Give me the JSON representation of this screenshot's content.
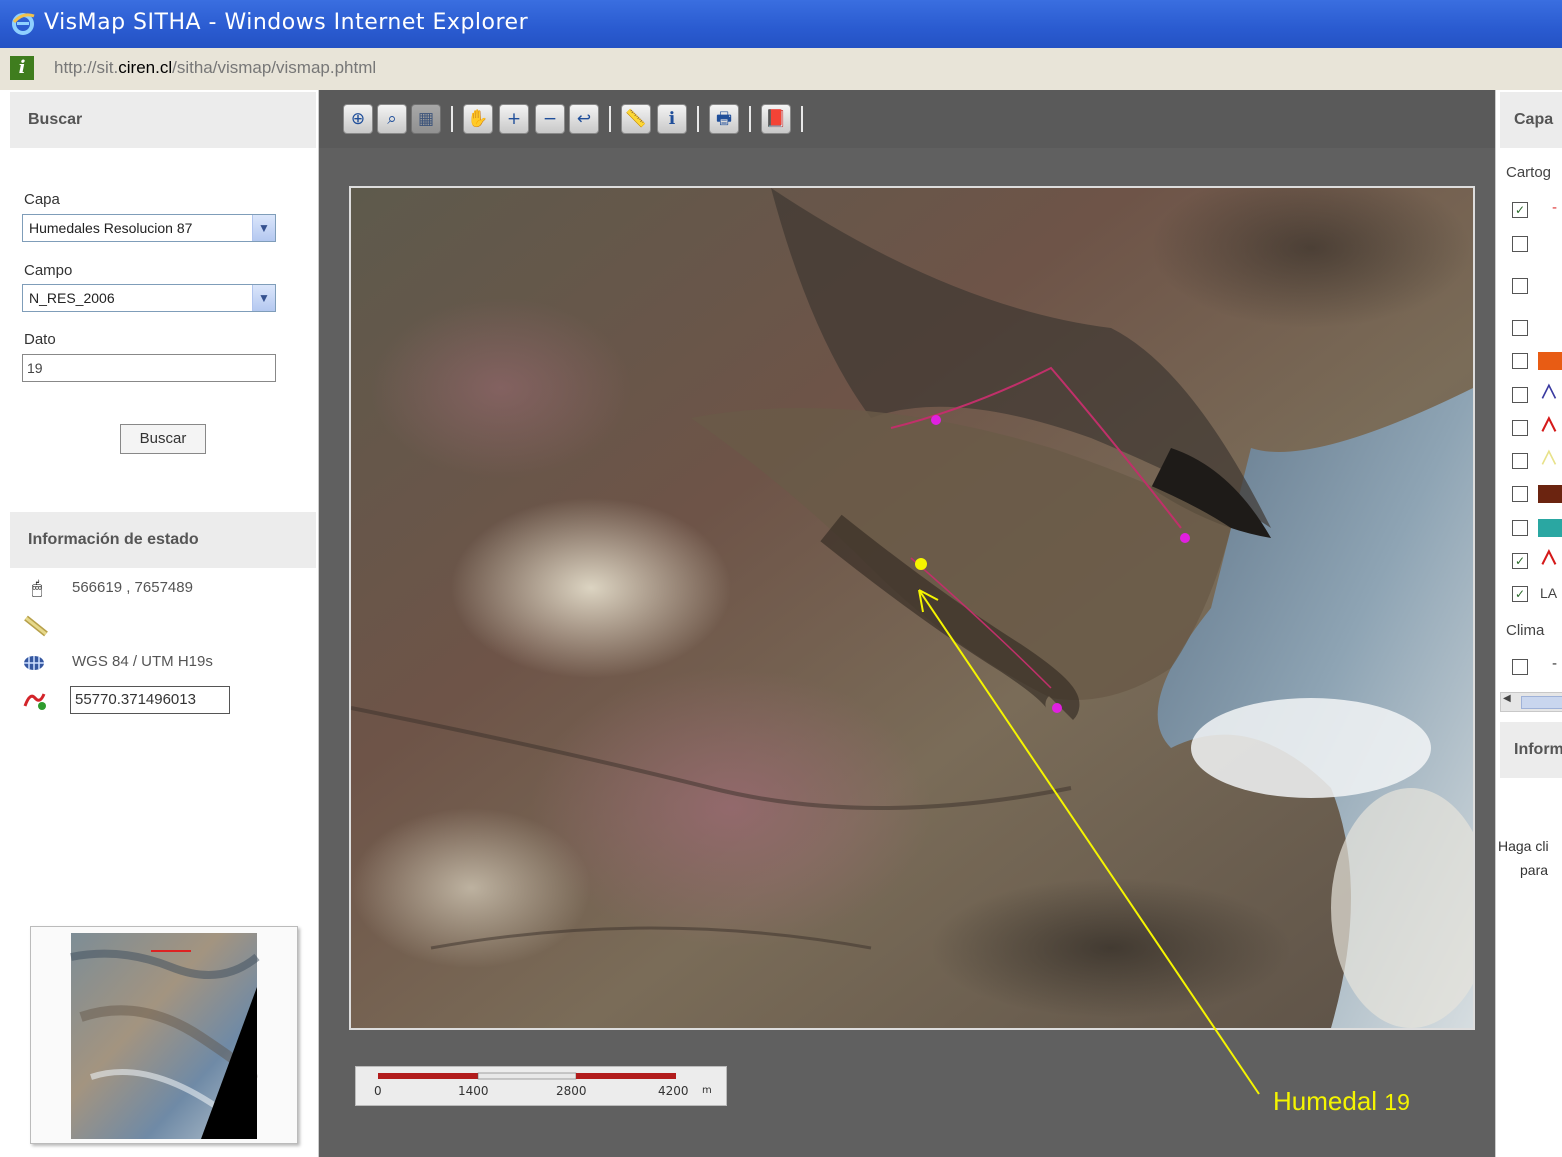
{
  "window": {
    "title": "VisMap SITHA - Windows Internet Explorer"
  },
  "address": {
    "prefix": "http://sit.",
    "domain": "ciren.cl",
    "path": "/sitha/vismap/vismap.phtml"
  },
  "left": {
    "search_header": "Buscar",
    "capa_label": "Capa",
    "capa_value": "Humedales Resolucion 87",
    "campo_label": "Campo",
    "campo_value": "N_RES_2006",
    "dato_label": "Dato",
    "dato_value": "19",
    "search_button": "Buscar",
    "status_header": "Información de estado",
    "coords": "566619  , 7657489",
    "projection": "WGS 84 / UTM H19s",
    "distance": "55770.371496013"
  },
  "scale": {
    "ticks": [
      "0",
      "1400",
      "2800",
      "4200"
    ],
    "unit": "m"
  },
  "annotation": {
    "label": "Humedal",
    "number": "19"
  },
  "right": {
    "header": "Capa",
    "group_cartography": "Cartog",
    "group_climate": "Clima",
    "layer_la": "LA",
    "info_header": "Inform",
    "help_line1": "Haga cli",
    "help_line2": "para"
  },
  "colors": {
    "titlebar": "#2a5bd0",
    "panel_header": "#ececec",
    "map_frame": "#606060",
    "annotation": "#ffff00"
  }
}
